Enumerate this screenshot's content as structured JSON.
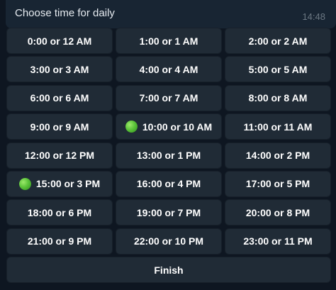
{
  "message": {
    "text": "Choose time for daily",
    "time": "14:48"
  },
  "keyboard": {
    "rows": [
      [
        {
          "label": "0:00 or 12 AM",
          "selected": false
        },
        {
          "label": "1:00 or 1 AM",
          "selected": false
        },
        {
          "label": "2:00 or 2 AM",
          "selected": false
        }
      ],
      [
        {
          "label": "3:00 or 3 AM",
          "selected": false
        },
        {
          "label": "4:00 or 4 AM",
          "selected": false
        },
        {
          "label": "5:00 or 5 AM",
          "selected": false
        }
      ],
      [
        {
          "label": "6:00 or 6 AM",
          "selected": false
        },
        {
          "label": "7:00 or 7 AM",
          "selected": false
        },
        {
          "label": "8:00 or 8 AM",
          "selected": false
        }
      ],
      [
        {
          "label": "9:00 or 9 AM",
          "selected": false
        },
        {
          "label": "10:00 or 10 AM",
          "selected": true
        },
        {
          "label": "11:00 or 11 AM",
          "selected": false
        }
      ],
      [
        {
          "label": "12:00 or 12 PM",
          "selected": false
        },
        {
          "label": "13:00 or 1 PM",
          "selected": false
        },
        {
          "label": "14:00 or 2 PM",
          "selected": false
        }
      ],
      [
        {
          "label": "15:00 or 3 PM",
          "selected": true
        },
        {
          "label": "16:00 or 4 PM",
          "selected": false
        },
        {
          "label": "17:00 or 5 PM",
          "selected": false
        }
      ],
      [
        {
          "label": "18:00 or 6 PM",
          "selected": false
        },
        {
          "label": "19:00 or 7 PM",
          "selected": false
        },
        {
          "label": "20:00 or 8 PM",
          "selected": false
        }
      ],
      [
        {
          "label": "21:00 or 9 PM",
          "selected": false
        },
        {
          "label": "22:00 or 10 PM",
          "selected": false
        },
        {
          "label": "23:00 or 11 PM",
          "selected": false
        }
      ]
    ],
    "finish_label": "Finish",
    "selected_icon": "green-circle-icon"
  },
  "colors": {
    "background": "#0e1621",
    "bubble": "#182533",
    "button": "#202b36",
    "selected_dot": "#5cc33a",
    "time_text": "#6c7883"
  }
}
